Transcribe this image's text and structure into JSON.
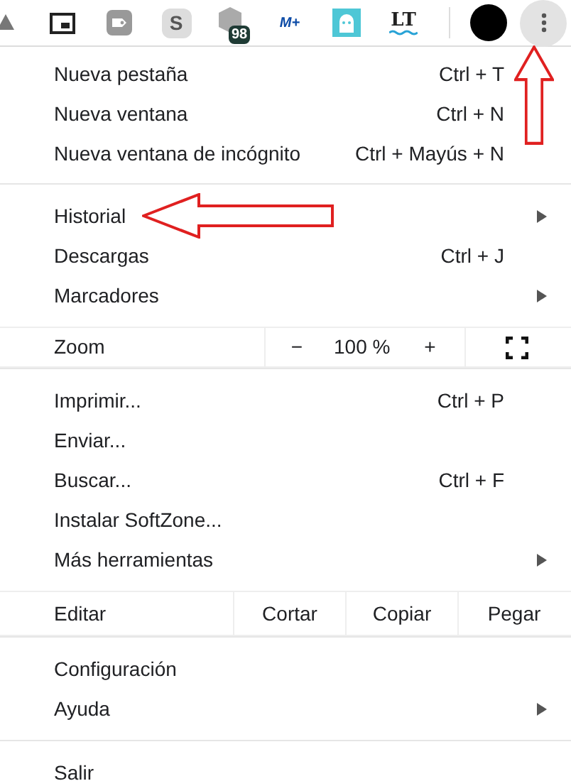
{
  "toolbar": {
    "extensions": [
      {
        "kind": "drive"
      },
      {
        "kind": "pip"
      },
      {
        "kind": "tag"
      },
      {
        "kind": "letter",
        "text": "S"
      },
      {
        "kind": "badge",
        "badge": "98"
      },
      {
        "kind": "movistar",
        "text": "M+"
      },
      {
        "kind": "ghost"
      },
      {
        "kind": "letter-wave",
        "text": "LT"
      }
    ],
    "menu_open": true
  },
  "sections": [
    {
      "items": [
        {
          "kind": "item",
          "label": "Nueva pestaña",
          "shortcut": "Ctrl + T",
          "submenu": false
        },
        {
          "kind": "item",
          "label": "Nueva ventana",
          "shortcut": "Ctrl + N",
          "submenu": false
        },
        {
          "kind": "item",
          "label": "Nueva ventana de incógnito",
          "shortcut": "Ctrl + Mayús + N",
          "submenu": false
        }
      ]
    },
    {
      "items": [
        {
          "kind": "item",
          "label": "Historial",
          "submenu": true
        },
        {
          "kind": "item",
          "label": "Descargas",
          "shortcut": "Ctrl + J",
          "submenu": false
        },
        {
          "kind": "item",
          "label": "Marcadores",
          "submenu": true
        }
      ]
    },
    {
      "items": [
        {
          "kind": "zoom",
          "label": "Zoom",
          "minus": "−",
          "value": "100 %",
          "plus": "+"
        }
      ]
    },
    {
      "items": [
        {
          "kind": "item",
          "label": "Imprimir...",
          "shortcut": "Ctrl + P",
          "submenu": false
        },
        {
          "kind": "item",
          "label": "Enviar...",
          "submenu": false
        },
        {
          "kind": "item",
          "label": "Buscar...",
          "shortcut": "Ctrl + F",
          "submenu": false
        },
        {
          "kind": "item",
          "label": "Instalar SoftZone...",
          "submenu": false
        },
        {
          "kind": "item",
          "label": "Más herramientas",
          "submenu": true
        }
      ]
    },
    {
      "items": [
        {
          "kind": "edit",
          "label": "Editar",
          "buttons": [
            "Cortar",
            "Copiar",
            "Pegar"
          ]
        }
      ]
    },
    {
      "items": [
        {
          "kind": "item",
          "label": "Configuración",
          "submenu": false
        },
        {
          "kind": "item",
          "label": "Ayuda",
          "submenu": true
        }
      ]
    },
    {
      "items": [
        {
          "kind": "item",
          "label": "Salir",
          "submenu": false
        }
      ]
    }
  ]
}
